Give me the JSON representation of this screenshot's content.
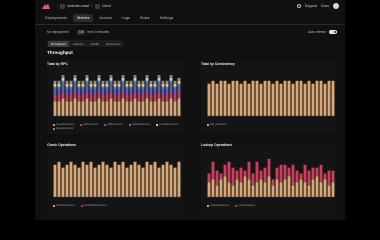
{
  "header": {
    "project": "website-crawl",
    "env": "Client",
    "support": "Support",
    "docs": "Docs"
  },
  "nav": {
    "tabs": [
      {
        "label": "Deployments",
        "active": false
      },
      {
        "label": "Metrics",
        "active": true
      },
      {
        "label": "Access",
        "active": false
      },
      {
        "label": "Logs",
        "active": false
      },
      {
        "label": "Roles",
        "active": false
      },
      {
        "label": "Settings",
        "active": false
      }
    ]
  },
  "controls": {
    "deployment": "for deployment",
    "range_value": "1M",
    "range_text": "from 0 minutes",
    "auto_refresh": "Auto refresh",
    "auto_refresh_on": true
  },
  "subtabs": [
    {
      "label": "Throughput",
      "active": true
    },
    {
      "label": "Latency",
      "active": false
    },
    {
      "label": "Health",
      "active": false
    },
    {
      "label": "Resources",
      "active": false
    }
  ],
  "section_title": "Throughput",
  "colors": {
    "tan": "#d9a878",
    "rose": "#c2435f",
    "purple": "#6e55b0",
    "teal": "#3d8a9e",
    "background": "#101010"
  },
  "chart_data": [
    {
      "type": "bar",
      "title": "Total by RPC",
      "stacked": true,
      "series": [
        {
          "name": "CreateDocument",
          "color": "#d9a878",
          "values": [
            5,
            5,
            6,
            5,
            5,
            6,
            5,
            5,
            6,
            5,
            5,
            6,
            5,
            5,
            6,
            5,
            5,
            6,
            5,
            5,
            6,
            5,
            5,
            6,
            5,
            5,
            6,
            5,
            5,
            6,
            5,
            6
          ]
        },
        {
          "name": "GetDocument",
          "color": "#c2435f",
          "values": [
            2,
            2,
            2,
            2,
            2,
            2,
            2,
            2,
            2,
            2,
            2,
            2,
            2,
            2,
            2,
            2,
            2,
            2,
            2,
            2,
            2,
            2,
            2,
            2,
            2,
            2,
            2,
            2,
            2,
            2,
            2,
            2
          ]
        },
        {
          "name": "ListDocuments",
          "color": "#6e55b0",
          "values": [
            2,
            2,
            3,
            2,
            2,
            3,
            2,
            2,
            3,
            2,
            2,
            3,
            2,
            2,
            3,
            2,
            2,
            3,
            2,
            2,
            3,
            2,
            2,
            3,
            2,
            2,
            3,
            2,
            2,
            3,
            2,
            2
          ]
        },
        {
          "name": "UpdateDocument",
          "color": "#3d8a9e",
          "values": [
            1,
            1,
            1,
            1,
            1,
            1,
            1,
            1,
            1,
            1,
            1,
            1,
            1,
            1,
            1,
            1,
            1,
            1,
            1,
            1,
            1,
            1,
            1,
            1,
            1,
            1,
            1,
            1,
            1,
            1,
            1,
            1
          ]
        },
        {
          "name": "LookupDocument",
          "color": "#e7c9a3",
          "values": [
            1,
            1,
            1,
            1,
            1,
            1,
            1,
            1,
            1,
            1,
            1,
            1,
            1,
            1,
            1,
            1,
            1,
            1,
            1,
            1,
            1,
            1,
            1,
            1,
            1,
            1,
            1,
            1,
            1,
            1,
            1,
            1
          ]
        },
        {
          "name": "DeleteDocument",
          "color": "#8a8a8a",
          "values": [
            1,
            1,
            1,
            1,
            1,
            1,
            1,
            1,
            1,
            1,
            1,
            1,
            1,
            1,
            1,
            1,
            1,
            1,
            1,
            1,
            1,
            1,
            1,
            1,
            1,
            1,
            1,
            1,
            1,
            1,
            1,
            1
          ]
        }
      ],
      "ylim": [
        0,
        15
      ]
    },
    {
      "type": "bar",
      "title": "Total by Consistency",
      "stacked": true,
      "series": [
        {
          "name": "fully_consistent",
          "color": "#d9a878",
          "values": [
            11,
            12,
            11,
            12,
            12,
            11,
            12,
            12,
            11,
            12,
            11,
            12,
            12,
            11,
            12,
            12,
            11,
            12,
            11,
            12,
            12,
            11,
            12,
            12,
            11,
            12,
            11,
            12,
            12,
            11,
            12,
            12
          ]
        }
      ],
      "ylim": [
        0,
        15
      ]
    },
    {
      "type": "bar",
      "title": "Check Operations",
      "stacked": true,
      "series": [
        {
          "name": "CheckPermission",
          "color": "#d9a878",
          "values": [
            11,
            12,
            10,
            11,
            12,
            11,
            10,
            12,
            11,
            12,
            10,
            11,
            12,
            11,
            10,
            12,
            11,
            12,
            10,
            11,
            12,
            11,
            10,
            12,
            11,
            12,
            10,
            11,
            12,
            11,
            10,
            12
          ]
        },
        {
          "name": "CheckBulkPermission",
          "color": "#c2435f",
          "values": [
            0,
            0,
            0,
            0,
            0,
            0,
            0,
            0,
            0,
            0,
            0,
            0,
            0,
            0,
            0,
            0,
            0,
            0,
            0,
            0,
            0,
            0,
            0,
            0,
            0,
            0,
            0,
            0,
            0,
            0,
            0,
            0
          ]
        }
      ],
      "ylim": [
        0,
        15
      ]
    },
    {
      "type": "bar",
      "title": "Lookup Operations",
      "stacked": true,
      "series": [
        {
          "name": "LookupResources",
          "color": "#d9a878",
          "values": [
            5,
            6,
            4,
            6,
            7,
            5,
            4,
            6,
            5,
            7,
            6,
            4,
            5,
            6,
            5,
            7,
            4,
            6,
            5,
            6,
            7,
            4,
            5,
            6,
            5,
            4,
            6,
            7,
            5,
            6,
            4,
            5
          ]
        },
        {
          "name": "LookupSubjects",
          "color": "#c2435f",
          "values": [
            3,
            6,
            5,
            2,
            4,
            7,
            6,
            3,
            5,
            2,
            6,
            4,
            7,
            3,
            5,
            6,
            2,
            4,
            6,
            5,
            3,
            7,
            4,
            2,
            6,
            5,
            4,
            3,
            6,
            2,
            5,
            4
          ]
        }
      ],
      "ylim": [
        0,
        15
      ]
    }
  ]
}
